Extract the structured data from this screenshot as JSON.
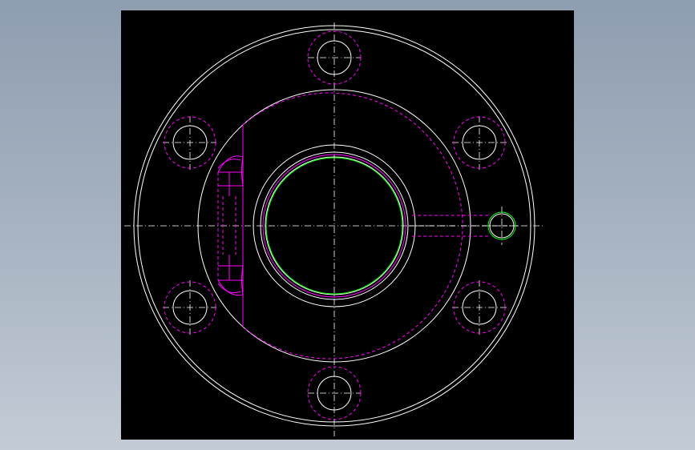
{
  "viewport": {
    "background": "#000000"
  },
  "colors": {
    "outline": "#ffffff",
    "hidden": "#ff00ff",
    "centerline": "#ffffff",
    "accent": "#00ff00",
    "window_gradient_top": "#8e9db0",
    "window_gradient_bottom": "#c3cbd6"
  },
  "drawing": {
    "type": "flange-top-view",
    "bolt_holes": 6,
    "line_types": [
      "continuous",
      "hidden-dashed",
      "center-dash-dot"
    ]
  }
}
